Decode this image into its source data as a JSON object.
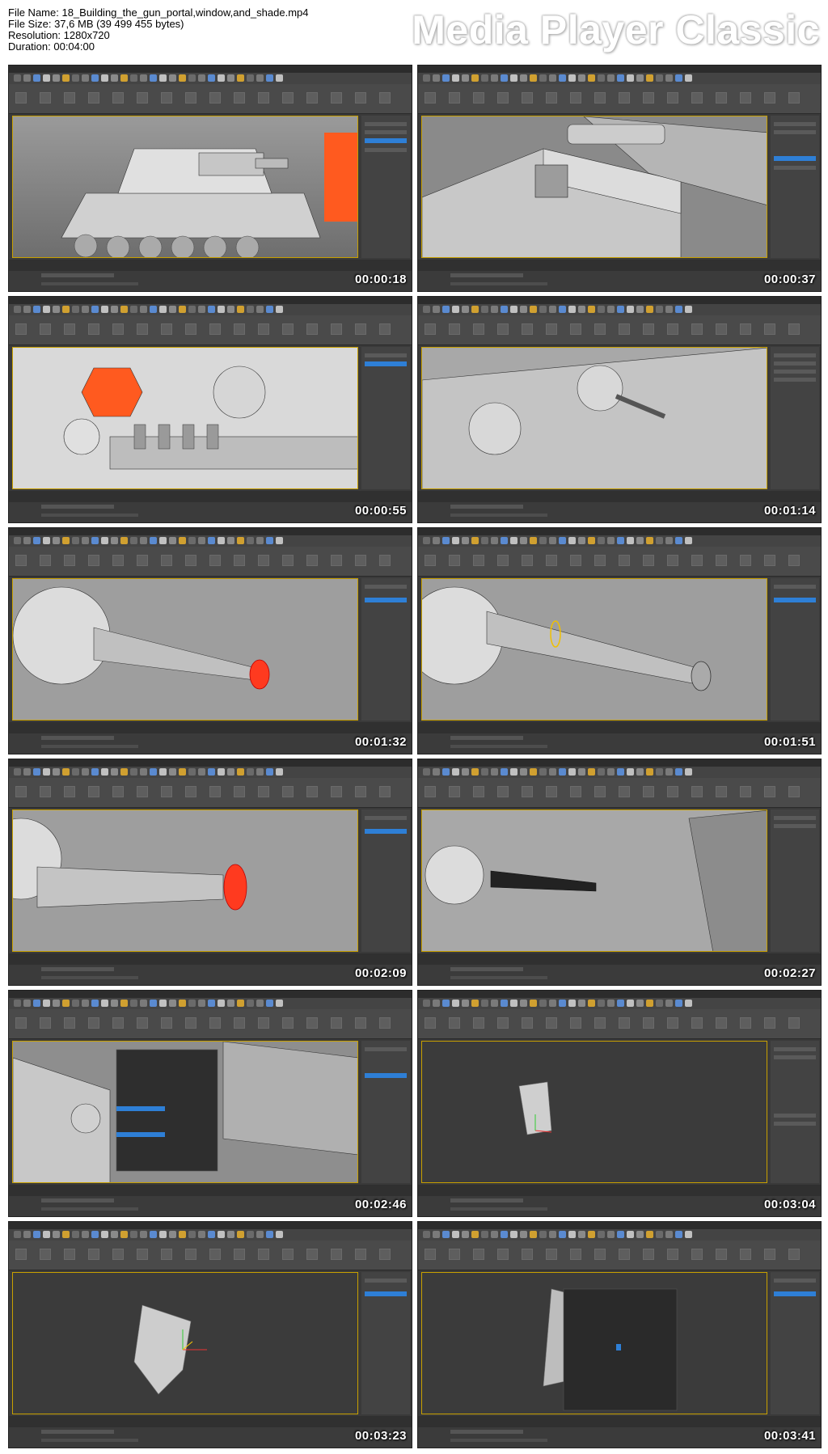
{
  "file_info": {
    "name_line": "File Name: 18_Building_the_gun_portal,window,and_shade.mp4",
    "size_line": "File Size: 37,6 MB (39 499 455 bytes)",
    "resolution_line": "Resolution: 1280x720",
    "duration_line": "Duration: 00:04:00"
  },
  "brand": "Media Player Classic",
  "thumbnails": [
    {
      "timestamp": "00:00:18",
      "scene": "tank-body"
    },
    {
      "timestamp": "00:00:37",
      "scene": "hull-box"
    },
    {
      "timestamp": "00:00:55",
      "scene": "spheres-front"
    },
    {
      "timestamp": "00:01:14",
      "scene": "spheres-barrel"
    },
    {
      "timestamp": "00:01:32",
      "scene": "barrel-red-tip"
    },
    {
      "timestamp": "00:01:51",
      "scene": "barrel-edit"
    },
    {
      "timestamp": "00:02:09",
      "scene": "barrel-closeup"
    },
    {
      "timestamp": "00:02:27",
      "scene": "barrel-far"
    },
    {
      "timestamp": "00:02:46",
      "scene": "quad-menu"
    },
    {
      "timestamp": "00:03:04",
      "scene": "shade-small"
    },
    {
      "timestamp": "00:03:23",
      "scene": "shade-large"
    },
    {
      "timestamp": "00:03:41",
      "scene": "shade-menu"
    }
  ],
  "colors": {
    "ui_dark": "#3a3a3a",
    "viewport_border": "#c8a000",
    "selection_blue": "#2e7fd6",
    "highlight_orange": "#ff5a1f"
  }
}
